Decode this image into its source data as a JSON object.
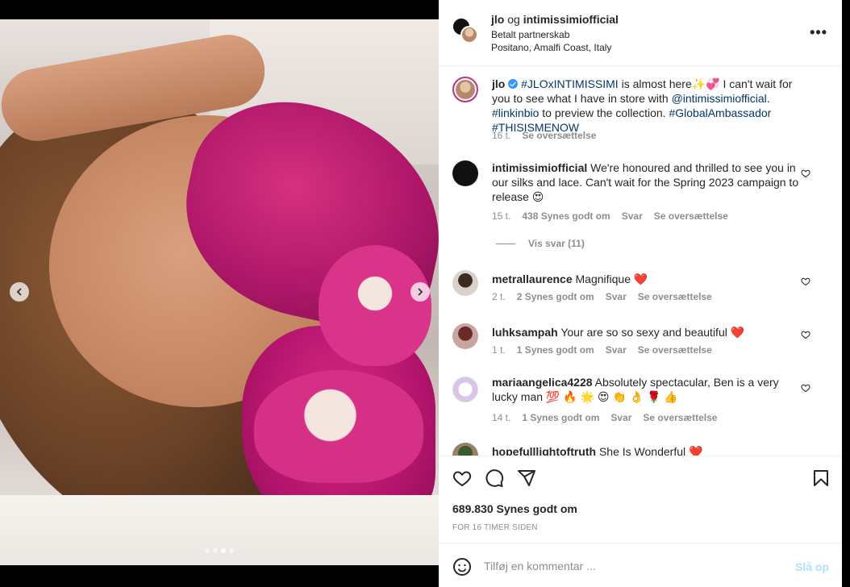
{
  "post": {
    "author": "jlo",
    "connector": "og",
    "partner": "intimissimiofficial",
    "paid_label": "Betalt partnerskab",
    "location": "Positano, Amalfi Coast, Italy",
    "more_label": "•••"
  },
  "caption": {
    "username": "jlo",
    "tag1": "#JLOxINTIMISSIMI",
    "text1": " is almost here✨💞 I can't wait for you to see what I have in store with ",
    "mention": "@intimissimiofficial",
    "text2": ". ",
    "tag2": "#linkinbio",
    "text3": " to preview the collection. ",
    "tag3": "#GlobalAmbassador",
    "text4": " ",
    "tag4": "#THISISMENOW",
    "time": "16 t.",
    "translate": "Se oversættelse"
  },
  "comments": [
    {
      "username": "intimissimiofficial",
      "text": " We're honoured and thrilled to see you in our silks and lace. Can't wait for the Spring 2023 campaign to release 😍",
      "time": "15 t.",
      "likes": "438 Synes godt om",
      "reply": "Svar",
      "translate": "Se oversættelse",
      "view_replies": "Vis svar (11)"
    },
    {
      "username": "metrallaurence",
      "text": " Magnifique ❤️",
      "time": "2 t.",
      "likes": "2 Synes godt om",
      "reply": "Svar",
      "translate": "Se oversættelse"
    },
    {
      "username": "luhksampah",
      "text": " Your are so so sexy and beautiful ❤️",
      "time": "1 t.",
      "likes": "1 Synes godt om",
      "reply": "Svar",
      "translate": "Se oversættelse"
    },
    {
      "username": "mariaangelica4228",
      "text": " Absolutely spectacular, Ben is a very lucky man 💯 🔥 🌟 😍 👏 👌 🌹 👍",
      "time": "14 t.",
      "likes": "1 Synes godt om",
      "reply": "Svar",
      "translate": "Se oversættelse"
    },
    {
      "username": "hopefulllightoftruth",
      "text": " She Is Wonderful ❤️"
    }
  ],
  "footer": {
    "likes": "689.830 Synes godt om",
    "time": "FOR 16 TIMER SIDEN"
  },
  "add_comment": {
    "placeholder": "Tilføj en kommentar ...",
    "post_label": "Slå op"
  },
  "carousel": {
    "slides": 4,
    "active": 3
  },
  "colors": {
    "link": "#00376b",
    "muted": "#8e8e8e",
    "verified": "#3897f0",
    "heart_red": "#ed4956",
    "post_disabled": "#b2dffc"
  },
  "icons": [
    "chevron-left-icon",
    "chevron-right-icon",
    "more-icon",
    "heart-icon",
    "comment-icon",
    "share-icon",
    "bookmark-icon",
    "emoji-icon",
    "verified-icon"
  ]
}
